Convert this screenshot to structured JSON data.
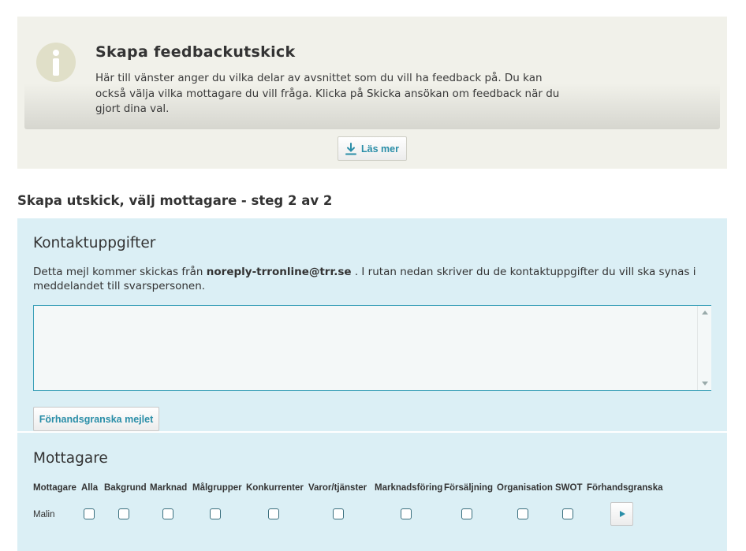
{
  "info": {
    "title": "Skapa feedbackutskick",
    "text": "Här till vänster anger du vilka delar av avsnittet som du vill ha feedback på. Du kan också välja vilka mottagare du vill fråga. Klicka på Skicka ansökan om feedback när du gjort dina val.",
    "read_more_label": "Läs mer",
    "icon": "info-icon",
    "read_more_icon": "download-icon"
  },
  "step_heading": "Skapa utskick, välj mottagare - steg 2 av 2",
  "contact": {
    "title": "Kontaktuppgifter",
    "text_before": "Detta mejl kommer skickas från",
    "email": "noreply-trronline@trr.se",
    "text_after": ". I rutan nedan skriver du de kontaktuppgifter du vill ska synas i meddelandet till svarspersonen.",
    "textarea_value": "",
    "preview_label": "Förhandsgranska mejlet"
  },
  "recipients": {
    "title": "Mottagare",
    "columns": [
      "Mottagare",
      "Alla",
      "Bakgrund",
      "Marknad",
      "Målgrupper",
      "Konkurrenter",
      "Varor/tjänster",
      "Marknadsföring",
      "Försäljning",
      "Organisation",
      "SWOT",
      "Förhandsgranska"
    ],
    "rows": [
      {
        "name": "Malin",
        "checked": [
          false,
          false,
          false,
          false,
          false,
          false,
          false,
          false,
          false,
          false
        ]
      }
    ],
    "preview_icon": "play-icon"
  },
  "colors": {
    "info_bg": "#f1f1ea",
    "panel_bg": "#dbeff5",
    "accent": "#2a8ea8",
    "textarea_border": "#3aa0b8"
  }
}
